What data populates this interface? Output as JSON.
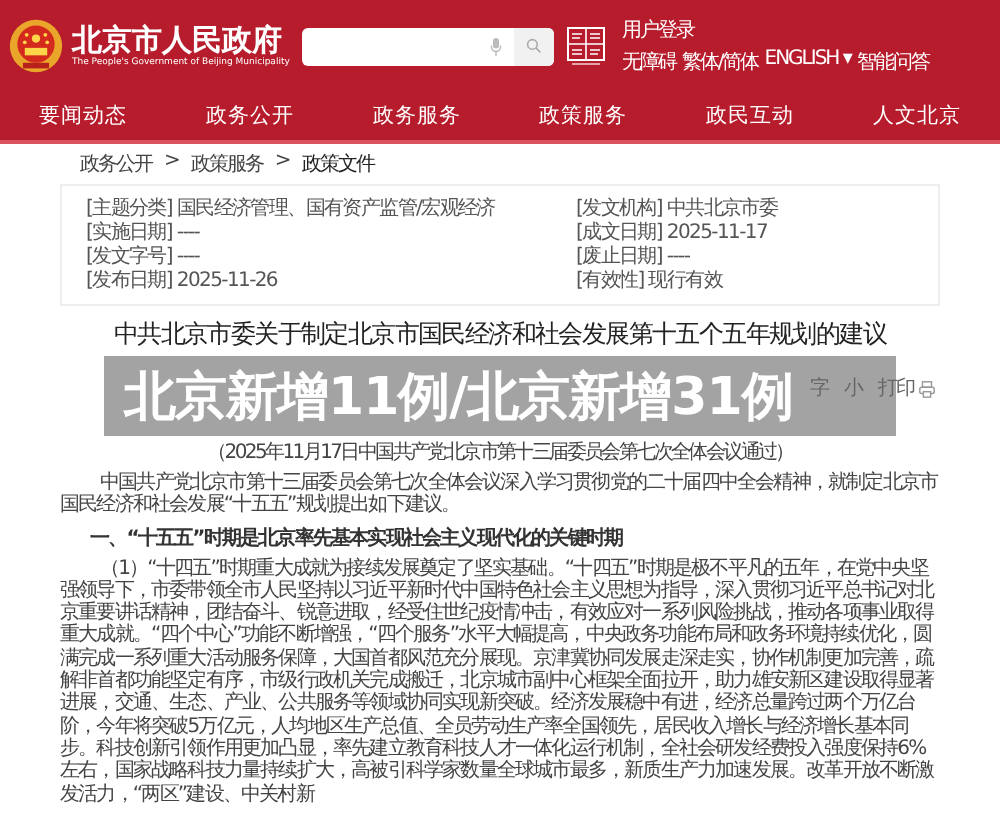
{
  "header": {
    "site_name": "北京市人民政府",
    "site_name_en": "The People's Government of Beijing Municipality",
    "login": "用户登录",
    "links": [
      {
        "text": "无障碍"
      },
      {
        "text": "繁体/简体"
      },
      {
        "text": "ENGLISH ▾"
      },
      {
        "text": "智能问答"
      }
    ]
  },
  "nav": [
    {
      "label": "要闻动态",
      "selected": false
    },
    {
      "label": "政务公开",
      "selected": false
    },
    {
      "label": "政务服务",
      "selected": false
    },
    {
      "label": "政策服务",
      "selected": false
    },
    {
      "label": "政民互动",
      "selected": false
    },
    {
      "label": "人文北京",
      "selected": false
    }
  ],
  "breadcrumb": [
    {
      "kind": "link",
      "text": "政务公开"
    },
    {
      "kind": "separator",
      "text": ">"
    },
    {
      "kind": "link",
      "text": "政策服务"
    },
    {
      "kind": "separator",
      "text": ">"
    },
    {
      "kind": "current",
      "text": "政策文件"
    }
  ],
  "info": [
    {
      "text": "[主题分类] 国民经济管理、国有资产监管/宏观经济"
    },
    {
      "text": "[发文机构] 中共北京市委"
    },
    {
      "text": "[实施日期] ----"
    },
    {
      "text": "[成文日期] 2025-11-17"
    },
    {
      "text": "[发文字号] ----"
    },
    {
      "text": "[废止日期] ----"
    },
    {
      "text": "[发布日期] 2025-11-26"
    },
    {
      "text": "[有效性] 现行有效"
    }
  ],
  "title": "中共北京市委关于制定北京市国民经济和社会发展第十五个五年规划的建议",
  "toolbar": [
    {
      "kind": "text",
      "text": "字"
    },
    {
      "kind": "text",
      "text": "小"
    },
    {
      "kind": "print",
      "text": "打印"
    }
  ],
  "overlay_caption": "北京新增11例/北京新增31例",
  "subtitle": "（2025年11月17日中国共产党北京市第十三届委员会第七次全体会议通过）",
  "body": [
    {
      "kind": "paragraph",
      "text": "中国共产党北京市第十三届委员会第七次全体会议深入学习贯彻党的二十届四中全会精神，就制定北京市国民经济和社会发展“十五五”规划提出如下建议。"
    },
    {
      "kind": "heading",
      "text": "一、“十五五”时期是北京率先基本实现社会主义现代化的关键时期"
    },
    {
      "kind": "paragraph",
      "text": "（1）“十四五”时期重大成就为接续发展奠定了坚实基础。“十四五”时期是极不平凡的五年，在党中央坚强领导下，市委带领全市人民坚持以习近平新时代中国特色社会主义思想为指导，深入贯彻习近平总书记对北京重要讲话精神，团结奋斗、锐意进取，经受住世纪疫情冲击，有效应对一系列风险挑战，推动各项事业取得重大成就。“四个中心”功能不断增强，“四个服务”水平大幅提高，中央政务功能布局和政务环境持续优化，圆满完成一系列重大活动服务保障，大国首都风范充分展现。京津冀协同发展走深走实，协作机制更加完善，疏解非首都功能坚定有序，市级行政机关完成搬迁，北京城市副中心框架全面拉开，助力雄安新区建设取得显著进展，交通、生态、产业、公共服务等领域协同实现新突破。经济发展稳中有进，经济总量跨过两个万亿台阶，今年将突破5万亿元，人均地区生产总值、全员劳动生产率全国领先，居民收入增长与经济增长基本同步。科技创新引领作用更加凸显，率先建立教育科技人才一体化运行机制，全社会研发经费投入强度保持6%左右，国家战略科技力量持续扩大，高被引科学家数量全球城市最多，新质生产力加速发展。改革开放不断激发活力，“两区”建设、中关村新"
    }
  ]
}
